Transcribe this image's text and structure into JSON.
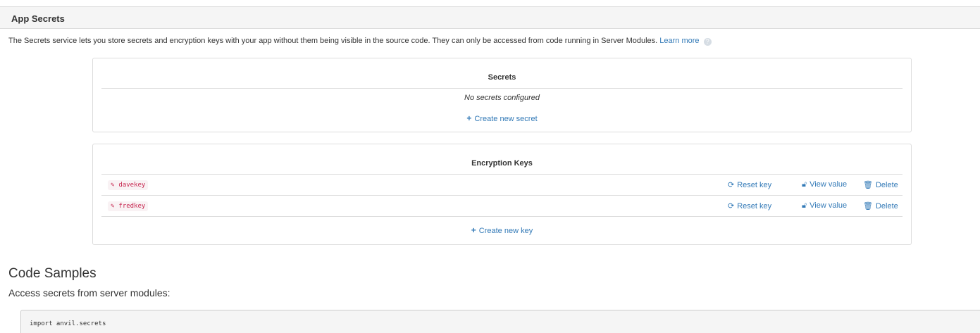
{
  "header": {
    "title": "App Secrets"
  },
  "intro": {
    "text": "The Secrets service lets you store secrets and encryption keys with your app without them being visible in the source code. They can only be accessed from code running in Server Modules.",
    "learn_more": "Learn more",
    "help_icon": "?"
  },
  "secrets_panel": {
    "title": "Secrets",
    "empty_message": "No secrets configured",
    "create_label": "Create new secret",
    "create_icon": "plus-icon"
  },
  "keys_panel": {
    "title": "Encryption Keys",
    "keys": [
      {
        "name": "davekey",
        "reset_label": "Reset key",
        "view_label": "View value",
        "delete_label": "Delete"
      },
      {
        "name": "fredkey",
        "reset_label": "Reset key",
        "view_label": "View value",
        "delete_label": "Delete"
      }
    ],
    "create_label": "Create new key",
    "icons": {
      "edit": "pencil-icon",
      "reset": "refresh-icon",
      "view": "unlock-icon",
      "delete": "trash-icon"
    }
  },
  "code_samples": {
    "title": "Code Samples",
    "subtitle": "Access secrets from server modules:",
    "code": "import anvil.secrets"
  },
  "colors": {
    "link": "#337ab7",
    "key_text": "#c7254e",
    "key_bg": "#f9f2f4",
    "header_bg": "#f5f5f5"
  }
}
